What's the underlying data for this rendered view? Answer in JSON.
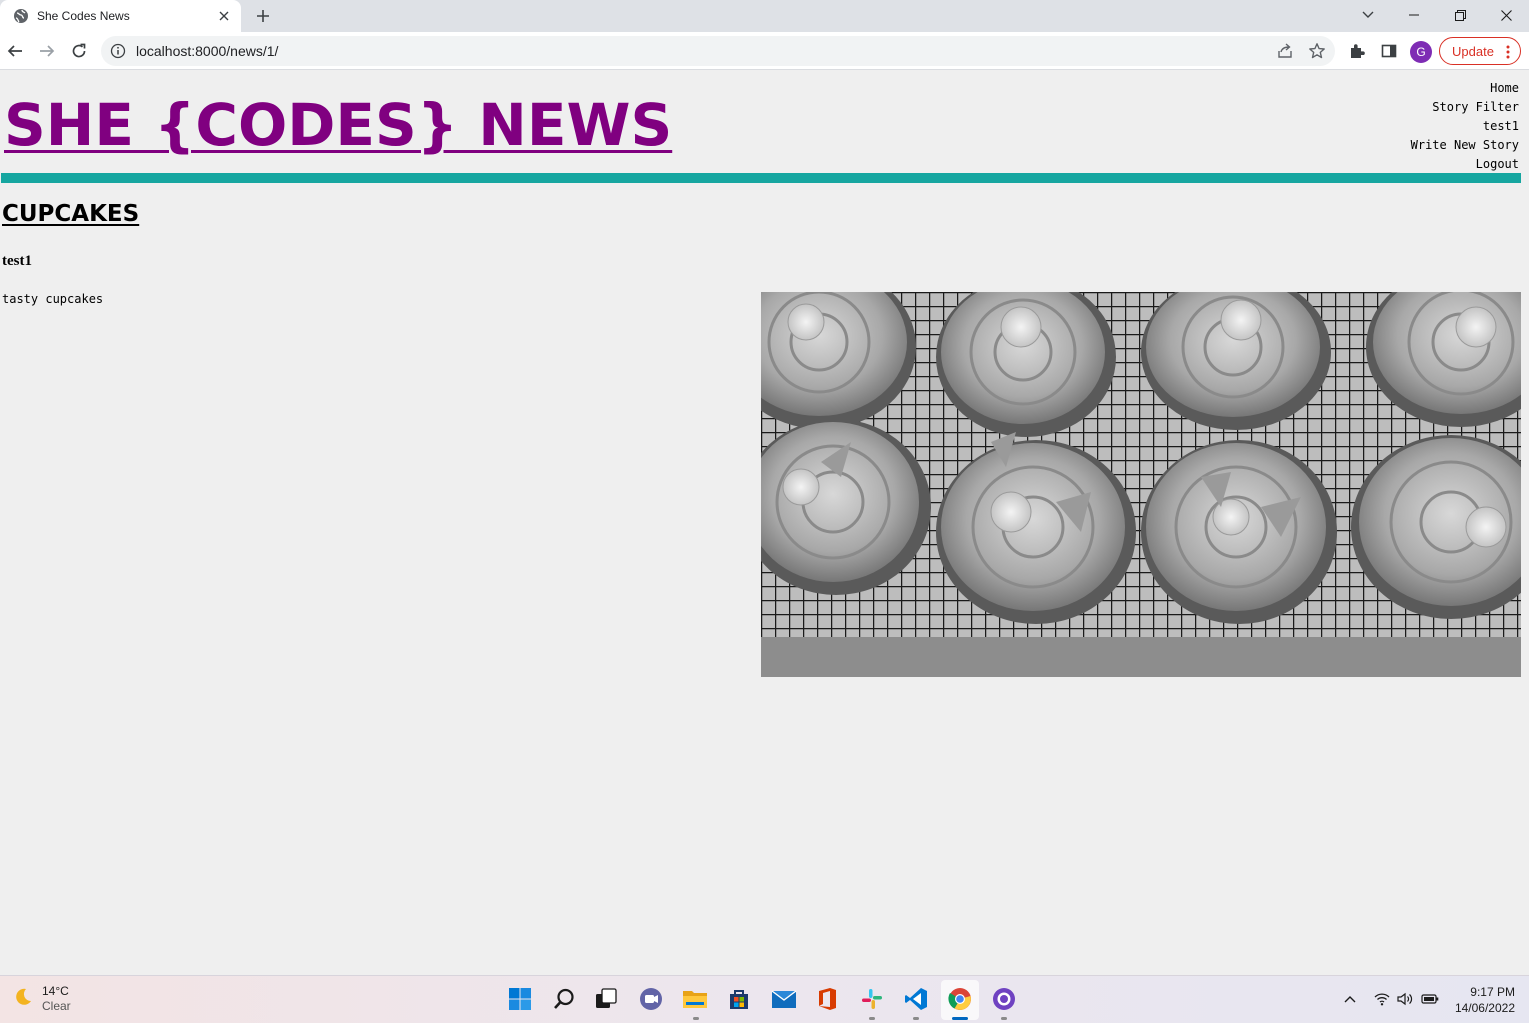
{
  "browser": {
    "tab_title": "She Codes News",
    "url": "localhost:8000/news/1/",
    "avatar_initial": "G",
    "update_label": "Update"
  },
  "site": {
    "title": "SHE {CODES} NEWS",
    "nav": [
      "Home",
      "Story Filter",
      "test1",
      "Write New Story",
      "Logout"
    ],
    "accent_color": "#16a6a0",
    "title_color": "#800080"
  },
  "story": {
    "title": "CUPCAKES",
    "author": "test1",
    "body": "tasty cupcakes",
    "image_alt": "cupcakes"
  },
  "taskbar": {
    "weather_temp": "14°C",
    "weather_condition": "Clear",
    "time": "9:17 PM",
    "date": "14/06/2022"
  }
}
